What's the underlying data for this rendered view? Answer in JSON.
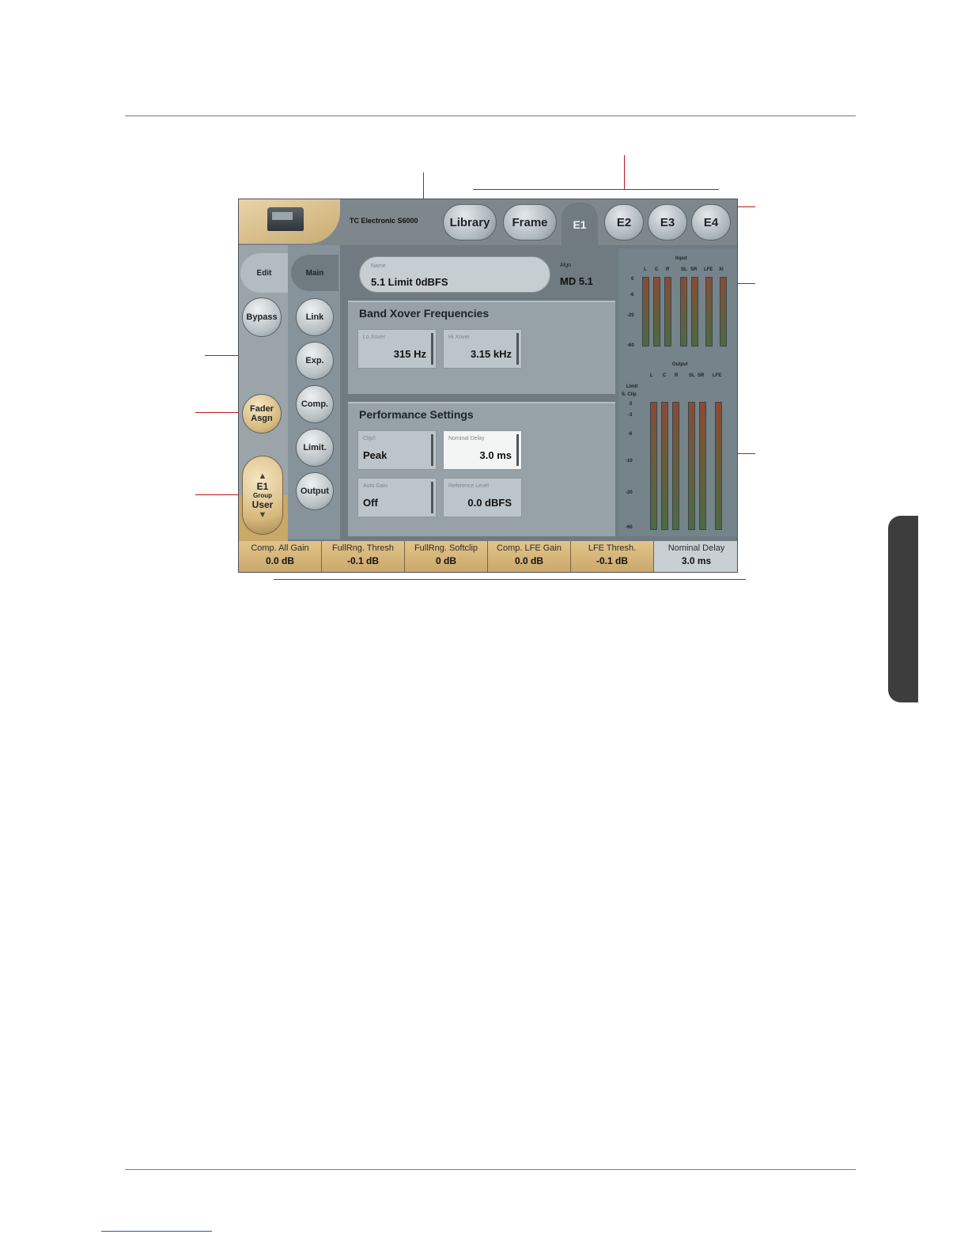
{
  "header": {
    "brand": "TC Electronic S6000",
    "tabs": [
      "Library",
      "Frame",
      "E1",
      "E2",
      "E3",
      "E4"
    ]
  },
  "sidebar": {
    "edit": "Edit",
    "bypass": "Bypass",
    "fader_line1": "Fader",
    "fader_line2": "Asgn",
    "group_top": "E1",
    "group_mid": "Group",
    "group_bottom": "User"
  },
  "subnav": [
    "Main",
    "Link",
    "Exp.",
    "Comp.",
    "Limit.",
    "Output"
  ],
  "preset": {
    "name_label": "Name",
    "name_value": "5.1 Limit 0dBFS",
    "algo_label": "Algo",
    "algo_value": "MD 5.1"
  },
  "xover": {
    "title": "Band Xover Frequencies",
    "lo_label": "Lo Xover",
    "lo_value": "315 Hz",
    "hi_label": "Hi Xover",
    "hi_value": "3.15 kHz"
  },
  "performance": {
    "title": "Performance Settings",
    "clip_label": "Clip/I",
    "clip_value": "Peak",
    "delay_label": "Nominal Delay",
    "delay_value": "3.0 ms",
    "autogain_label": "Auto Gain",
    "autogain_value": "Off",
    "ref_label": "Reference Level",
    "ref_value": "0.0 dBFS"
  },
  "meters": {
    "input_title": "Input",
    "input_channels": [
      "L",
      "C",
      "R",
      "SL",
      "SR",
      "LFE",
      "Xl"
    ],
    "input_scale": [
      "0",
      "-6",
      "-20",
      "-60"
    ],
    "output_title": "Output",
    "output_channels": [
      "L",
      "C",
      "R",
      "SL",
      "SR",
      "LFE"
    ],
    "limit_label_1": "Limit",
    "limit_label_2": "S. Clip",
    "output_scale": [
      "0",
      "-3",
      "-6",
      "-10",
      "-20",
      "-60"
    ]
  },
  "footer": [
    {
      "label": "Comp. All Gain",
      "value": "0.0 dB"
    },
    {
      "label": "FullRng. Thresh",
      "value": "-0.1 dB"
    },
    {
      "label": "FullRng. Softclip",
      "value": "0 dB"
    },
    {
      "label": "Comp. LFE Gain",
      "value": "0.0 dB"
    },
    {
      "label": "LFE Thresh.",
      "value": "-0.1 dB"
    },
    {
      "label": "Nominal Delay",
      "value": "3.0 ms"
    }
  ]
}
